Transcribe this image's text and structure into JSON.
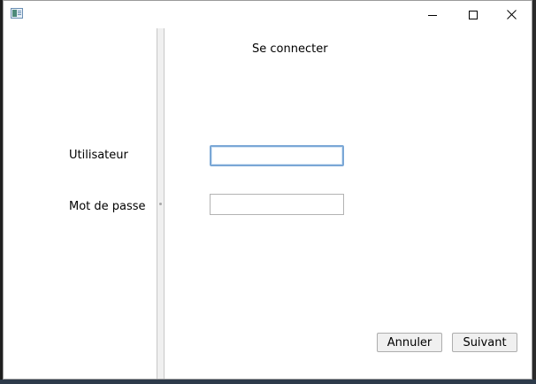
{
  "window": {
    "title": "",
    "app_icon": "app-window-icon",
    "controls": {
      "minimize": "minimize-icon",
      "maximize": "maximize-icon",
      "close": "close-icon"
    }
  },
  "login": {
    "heading": "Se connecter",
    "username_label": "Utilisateur",
    "username_value": "",
    "password_label": "Mot de passe",
    "password_value": "",
    "cancel_label": "Annuler",
    "next_label": "Suivant"
  },
  "colors": {
    "focus_border": "#7aa7d6",
    "button_face": "#f0f0f0",
    "window_bg": "#ffffff"
  }
}
